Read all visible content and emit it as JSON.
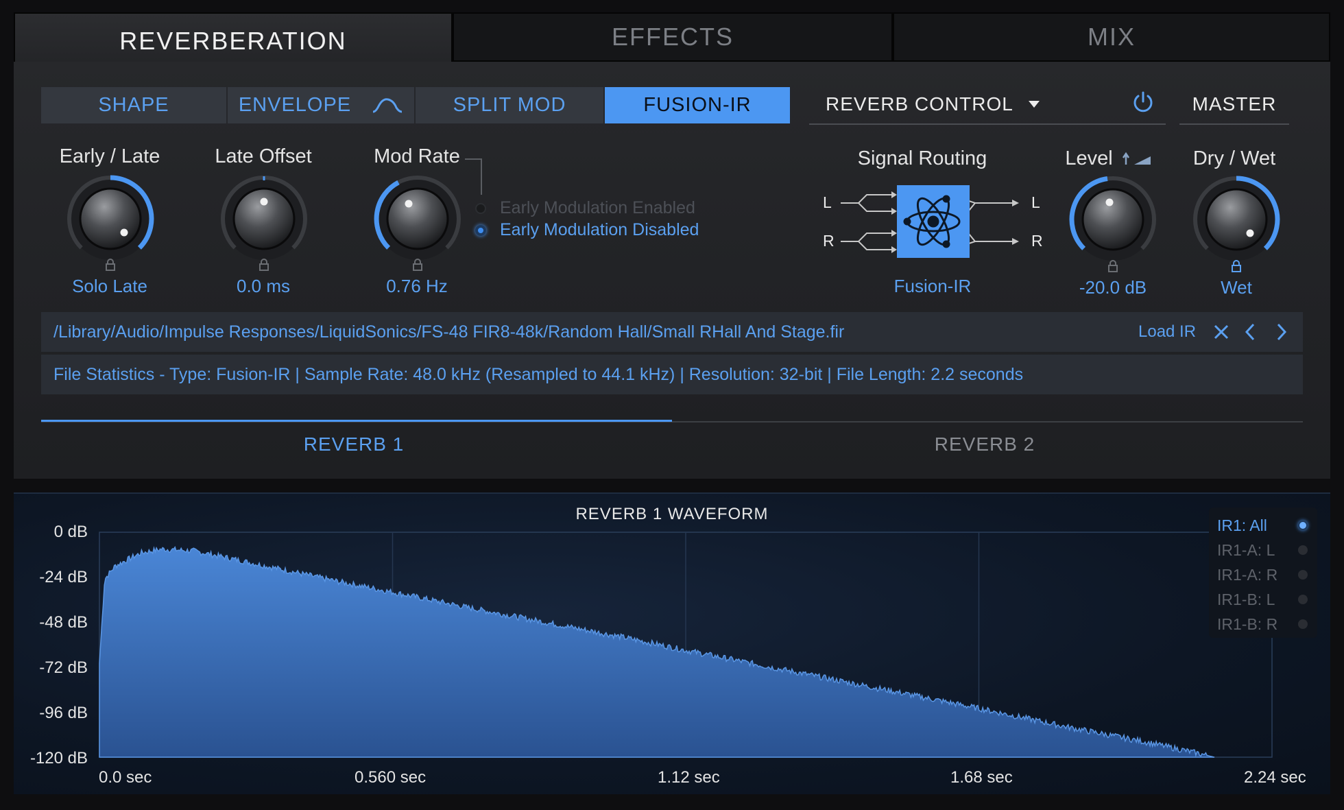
{
  "top_tabs": [
    "REVERBERATION",
    "EFFECTS",
    "MIX"
  ],
  "sub_tabs": [
    "SHAPE",
    "ENVELOPE",
    "SPLIT MOD",
    "FUSION-IR"
  ],
  "reverb_control": {
    "label": "REVERB CONTROL",
    "master": "MASTER"
  },
  "knobs": [
    {
      "label": "Early / Late",
      "value": "Solo Late",
      "position": 1.0
    },
    {
      "label": "Late Offset",
      "value": "0.0 ms",
      "position": 0.5
    },
    {
      "label": "Mod Rate",
      "value": "0.76 Hz",
      "position": 0.35
    },
    {
      "label": "Level",
      "value": "-20.0 dB",
      "position": 0.45
    },
    {
      "label": "Dry / Wet",
      "value": "Wet",
      "position": 1.0
    }
  ],
  "modulation_options": [
    "Early Modulation Enabled",
    "Early Modulation Disabled"
  ],
  "modulation_selected": "Early Modulation Disabled",
  "signal_routing": {
    "label": "Signal Routing",
    "value": "Fusion-IR",
    "inputs": [
      "L",
      "R"
    ],
    "outputs": [
      "L",
      "R"
    ]
  },
  "ir_path": "/Library/Audio/Impulse Responses/LiquidSonics/FS-48 FIR8-48k/Random Hall/Small RHall And Stage.fir",
  "load_ir": "Load IR",
  "file_stats": "File Statistics - Type: Fusion-IR | Sample Rate: 48.0 kHz (Resampled to 44.1 kHz) | Resolution: 32-bit | File Length: 2.2 seconds",
  "reverb_tabs": [
    "REVERB 1",
    "REVERB 2"
  ],
  "active_reverb": "REVERB 1",
  "legend": [
    "IR1: All",
    "IR1-A: L",
    "IR1-A: R",
    "IR1-B: L",
    "IR1-B: R"
  ],
  "legend_selected": "IR1: All",
  "chart_data": {
    "type": "area",
    "title": "REVERB 1 WAVEFORM",
    "y_ticks": [
      "0 dB",
      "-24 dB",
      "-48 dB",
      "-72 dB",
      "-96 dB",
      "-120 dB"
    ],
    "x_ticks": [
      "0.0 sec",
      "0.560 sec",
      "1.12 sec",
      "1.68 sec",
      "2.24 sec"
    ],
    "ylim": [
      -120,
      0
    ],
    "xlim": [
      0,
      2.24
    ],
    "grid": true,
    "series": [
      {
        "x": [
          0.0,
          0.01,
          0.03,
          0.08,
          0.12,
          0.18,
          0.25,
          0.35,
          0.45,
          0.56,
          0.7,
          0.85,
          1.0,
          1.12,
          1.3,
          1.5,
          1.68,
          1.85,
          2.0,
          2.1,
          2.13
        ],
        "values": [
          -70,
          -25,
          -18,
          -11,
          -9,
          -10,
          -14,
          -20,
          -26,
          -32,
          -40,
          -48,
          -56,
          -63,
          -73,
          -84,
          -94,
          -104,
          -112,
          -118,
          -120
        ]
      }
    ]
  },
  "colors": {
    "accent": "#4c97f2",
    "text_blue": "#5ba0f0",
    "panel": "#232427",
    "wave_fill": "#3b72c0"
  }
}
